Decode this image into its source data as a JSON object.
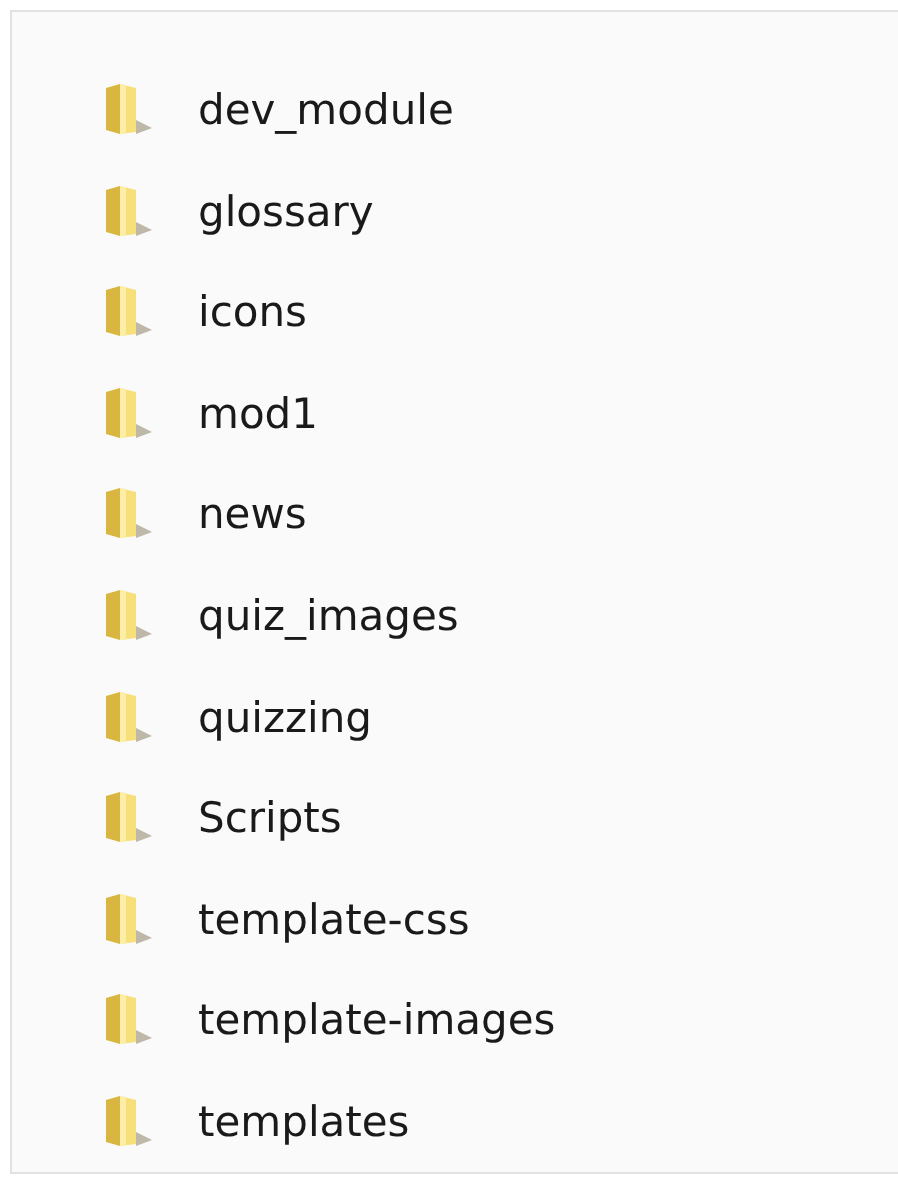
{
  "folders": [
    {
      "name": "dev_module"
    },
    {
      "name": "glossary"
    },
    {
      "name": "icons"
    },
    {
      "name": "mod1"
    },
    {
      "name": "news"
    },
    {
      "name": "quiz_images"
    },
    {
      "name": "quizzing"
    },
    {
      "name": "Scripts"
    },
    {
      "name": "template-css"
    },
    {
      "name": "template-images"
    },
    {
      "name": "templates"
    }
  ]
}
